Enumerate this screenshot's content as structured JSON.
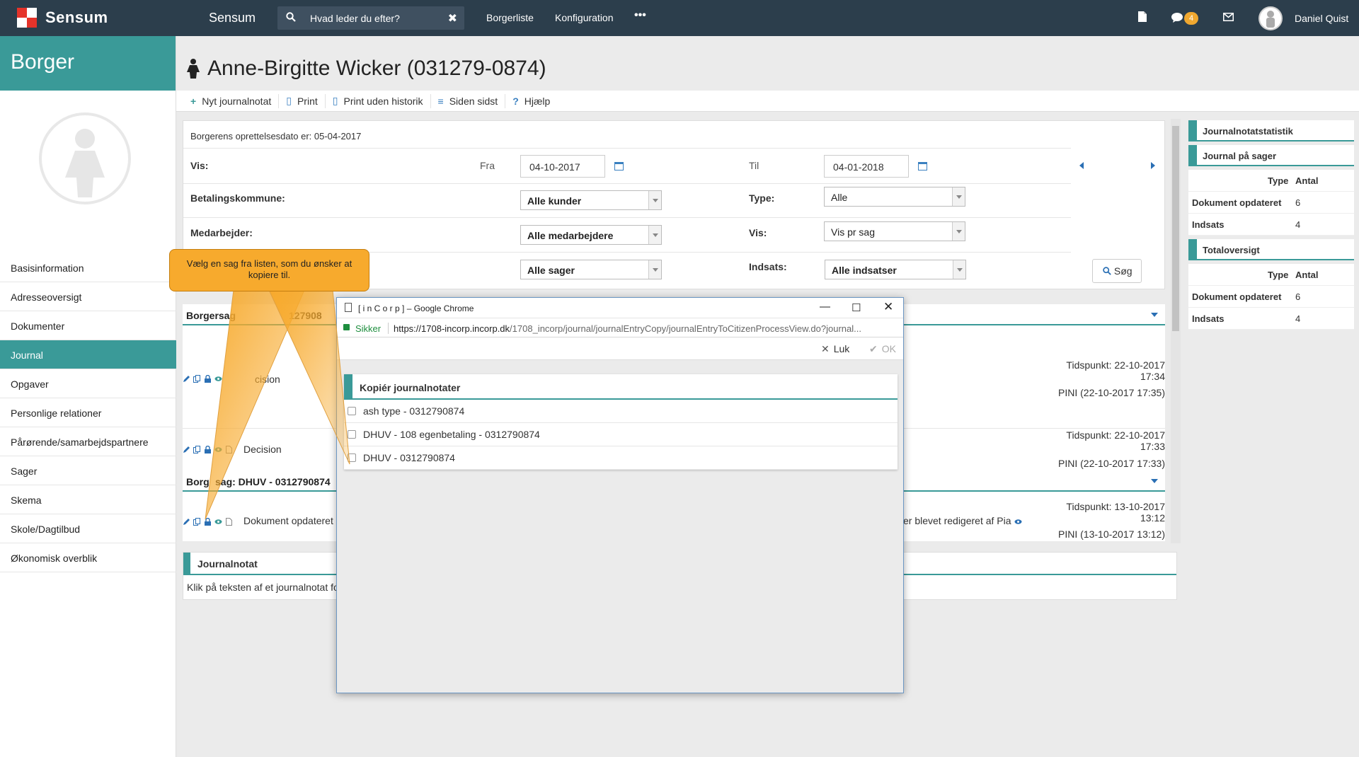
{
  "topbar": {
    "brand": "Sensum",
    "app_title": "Sensum",
    "search_placeholder": "Hvad leder du efter?",
    "clear": "✖",
    "nav": [
      "Borgerliste",
      "Konfiguration"
    ],
    "more": "•••",
    "message_count": "4",
    "user_name": "Daniel Quist"
  },
  "sidebar": {
    "title": "Borger",
    "items": [
      "Basisinformation",
      "Adresseoversigt",
      "Dokumenter",
      "Journal",
      "Opgaver",
      "Personlige relationer",
      "Pårørende/samarbejdspartnere",
      "Sager",
      "Skema",
      "Skole/Dagtilbud",
      "Økonomisk overblik"
    ],
    "active": "Journal"
  },
  "page": {
    "title": "Anne-Birgitte Wicker (031279-0874)"
  },
  "toolbar": {
    "new_note": "Nyt journalnotat",
    "print": "Print",
    "print_no_history": "Print uden historik",
    "since_last": "Siden sidst",
    "help": "Hjælp"
  },
  "filter": {
    "created": "Borgerens oprettelsesdato er: 05-04-2017",
    "vis_label": "Vis:",
    "fra_label": "Fra",
    "fra_value": "04-10-2017",
    "til_label": "Til",
    "til_value": "04-01-2018",
    "betaling_label": "Betalingskommune:",
    "betaling_value": "Alle kunder",
    "type_label": "Type:",
    "type_value": "Alle",
    "medarbejder_label": "Medarbejder:",
    "medarbejder_value": "Alle medarbejdere",
    "vis2_label": "Vis:",
    "vis2_value": "Vis pr sag",
    "sager_value": "Alle sager",
    "indsats_label": "Indsats:",
    "indsats_value": "Alle indsatser",
    "search_button": "Søg"
  },
  "list": {
    "group1_head": "Borgersag",
    "group1_head_tail": "127908",
    "row1_text": "cision",
    "row1_time": "Tidspunkt: 22-10-2017 17:34",
    "row1_user": "PINI (22-10-2017 17:35)",
    "row2_text": "Decision",
    "row2_time": "Tidspunkt: 22-10-2017 17:33",
    "row2_user": "PINI (22-10-2017 17:33)",
    "group2_head_a": "Borg",
    "group2_head_b": "sag: DHUV - 0312790874",
    "row3_text": "Dokument opdateret",
    "row3_right": "er blevet redigeret af Pia",
    "row3_time": "Tidspunkt: 13-10-2017 13:12",
    "row3_user": "PINI (13-10-2017 13:12)"
  },
  "journalnotat": {
    "title": "Journalnotat",
    "body": "Klik på teksten af et journalnotat fo"
  },
  "stats": {
    "head1": "Journalnotatstatistik",
    "head2": "Journal på sager",
    "col_type": "Type",
    "col_antal": "Antal",
    "sager_rows": [
      {
        "type": "Dokument opdateret",
        "antal": "6"
      },
      {
        "type": "Indsats",
        "antal": "4"
      }
    ],
    "head3": "Totaloversigt",
    "total_rows": [
      {
        "type": "Dokument opdateret",
        "antal": "6"
      },
      {
        "type": "Indsats",
        "antal": "4"
      }
    ]
  },
  "popup": {
    "window_title": "[ i n C o r p ] – Google Chrome",
    "secure_label": "Sikker",
    "url_host": "https://1708-incorp.incorp.dk",
    "url_path": "/1708_incorp/journal/journalEntryCopy/journalEntryToCitizenProcessView.do?journal...",
    "luk": "Luk",
    "ok": "OK",
    "panel_title": "Kopiér journalnotater",
    "items": [
      "ash type - 0312790874",
      "DHUV - 108 egenbetaling - 0312790874",
      "DHUV - 0312790874"
    ]
  },
  "callout": {
    "text": "Vælg en sag fra listen, som du ønsker at kopiere til."
  },
  "colors": {
    "topbar": "#2c3e4c",
    "accent": "#3a9a98",
    "callout": "#f7aa2d",
    "badge": "#f0a830"
  }
}
